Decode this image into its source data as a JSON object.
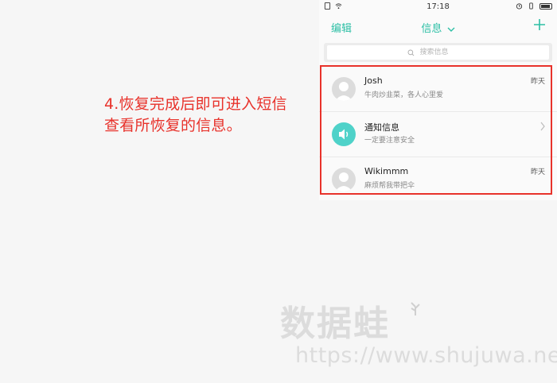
{
  "caption": {
    "line1": "4.恢复完成后即可进入短信",
    "line2": "查看所恢复的信息。"
  },
  "status_bar": {
    "time": "17:18"
  },
  "header": {
    "edit_label": "编辑",
    "title": "信息",
    "add_icon": "plus-icon"
  },
  "search": {
    "placeholder": "搜索信息"
  },
  "messages": [
    {
      "name": "Josh",
      "preview": "牛肉炒韭菜，各人心里爱",
      "date": "昨天",
      "avatar": "person-avatar"
    },
    {
      "name": "通知信息",
      "preview": "一定要注意安全",
      "date": "",
      "avatar": "speaker-icon"
    },
    {
      "name": "Wikimmm",
      "preview": "麻烦帮我带把伞",
      "date": "昨天",
      "avatar": "person-avatar"
    }
  ],
  "watermark": {
    "logo_text": "数据蛙",
    "url": "https://www.shujuwa.net"
  },
  "colors": {
    "accent": "#2cbfa5",
    "highlight_red": "#e8322b",
    "notification_avatar": "#4fd2c9"
  }
}
